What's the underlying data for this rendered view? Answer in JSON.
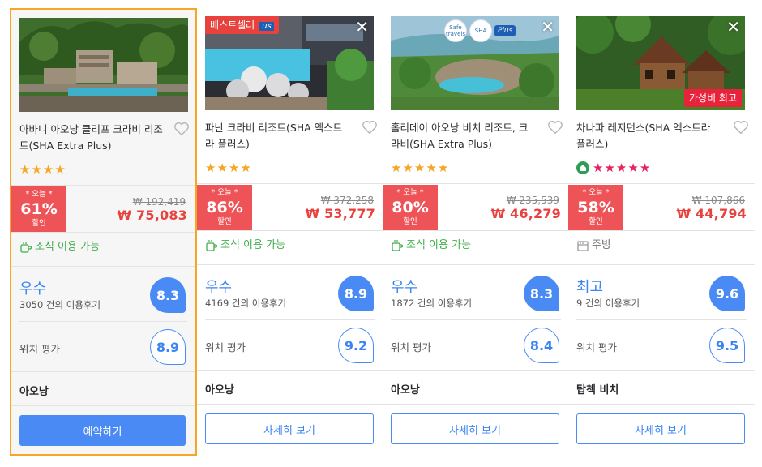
{
  "colors": {
    "accent_blue": "#4a8af4",
    "discount_red": "#ee5357",
    "price_red": "#e8423f",
    "selected_border": "#f5a623",
    "amenity_green": "#3fae49"
  },
  "cards": [
    {
      "name": "아바니 아오낭 클리프 크라비 리조트(SHA Extra Plus)",
      "stars": [
        "★",
        "★",
        "★",
        "★"
      ],
      "deal": {
        "today": "* 오늘 *",
        "pct": "61%",
        "off": "할인"
      },
      "orig_price": "₩ 192,419",
      "price": "₩ 75,083",
      "amenity": "조식 이용 가능",
      "amenity_icon": "coffee-cup-icon",
      "rating_word": "우수",
      "reviews": "3050 건의 이용후기",
      "score": "8.3",
      "loc_label": "위치 평가",
      "loc_score": "8.9",
      "area": "아오낭",
      "button": "예약하기"
    },
    {
      "name": "파난 크라비 리조트(SHA 엑스트라 플러스)",
      "badge": "베스트셀러",
      "badge_tail": "us",
      "stars": [
        "★",
        "★",
        "★",
        "★"
      ],
      "deal": {
        "today": "* 오늘 *",
        "pct": "86%",
        "off": "할인"
      },
      "orig_price": "₩ 372,258",
      "price": "₩ 53,777",
      "amenity": "조식 이용 가능",
      "amenity_icon": "coffee-cup-icon",
      "rating_word": "우수",
      "reviews": "4169 건의 이용후기",
      "score": "8.9",
      "loc_label": "위치 평가",
      "loc_score": "9.2",
      "area": "아오낭",
      "button": "자세히 보기"
    },
    {
      "name": "홀리데이 아오낭 비치 리조트, 크라비(SHA Extra Plus)",
      "sha_badge_1": "Safe travels",
      "sha_badge_2": "SHA",
      "sha_badge_3": "Plus",
      "stars": [
        "★",
        "★",
        "★",
        "★",
        "★"
      ],
      "deal": {
        "today": "* 오늘 *",
        "pct": "80%",
        "off": "할인"
      },
      "orig_price": "₩ 235,539",
      "price": "₩ 46,279",
      "amenity": "조식 이용 가능",
      "amenity_icon": "coffee-cup-icon",
      "rating_word": "우수",
      "reviews": "1872 건의 이용후기",
      "score": "8.3",
      "loc_label": "위치 평가",
      "loc_score": "8.4",
      "area": "아오낭",
      "button": "자세히 보기"
    },
    {
      "name": "차나파 레지던스(SHA 엑스트라 플러스)",
      "badge_value": "가성비 최고",
      "stars": [
        "★",
        "★",
        "★",
        "★",
        "★"
      ],
      "deal": {
        "today": "* 오늘 *",
        "pct": "58%",
        "off": "할인"
      },
      "orig_price": "₩ 107,866",
      "price": "₩ 44,794",
      "amenity": "주방",
      "amenity_icon": "kitchen-icon",
      "rating_word": "최고",
      "reviews": "9 건의 이용후기",
      "score": "9.6",
      "loc_label": "위치 평가",
      "loc_score": "9.5",
      "area": "탑첵 비치",
      "button": "자세히 보기"
    }
  ]
}
